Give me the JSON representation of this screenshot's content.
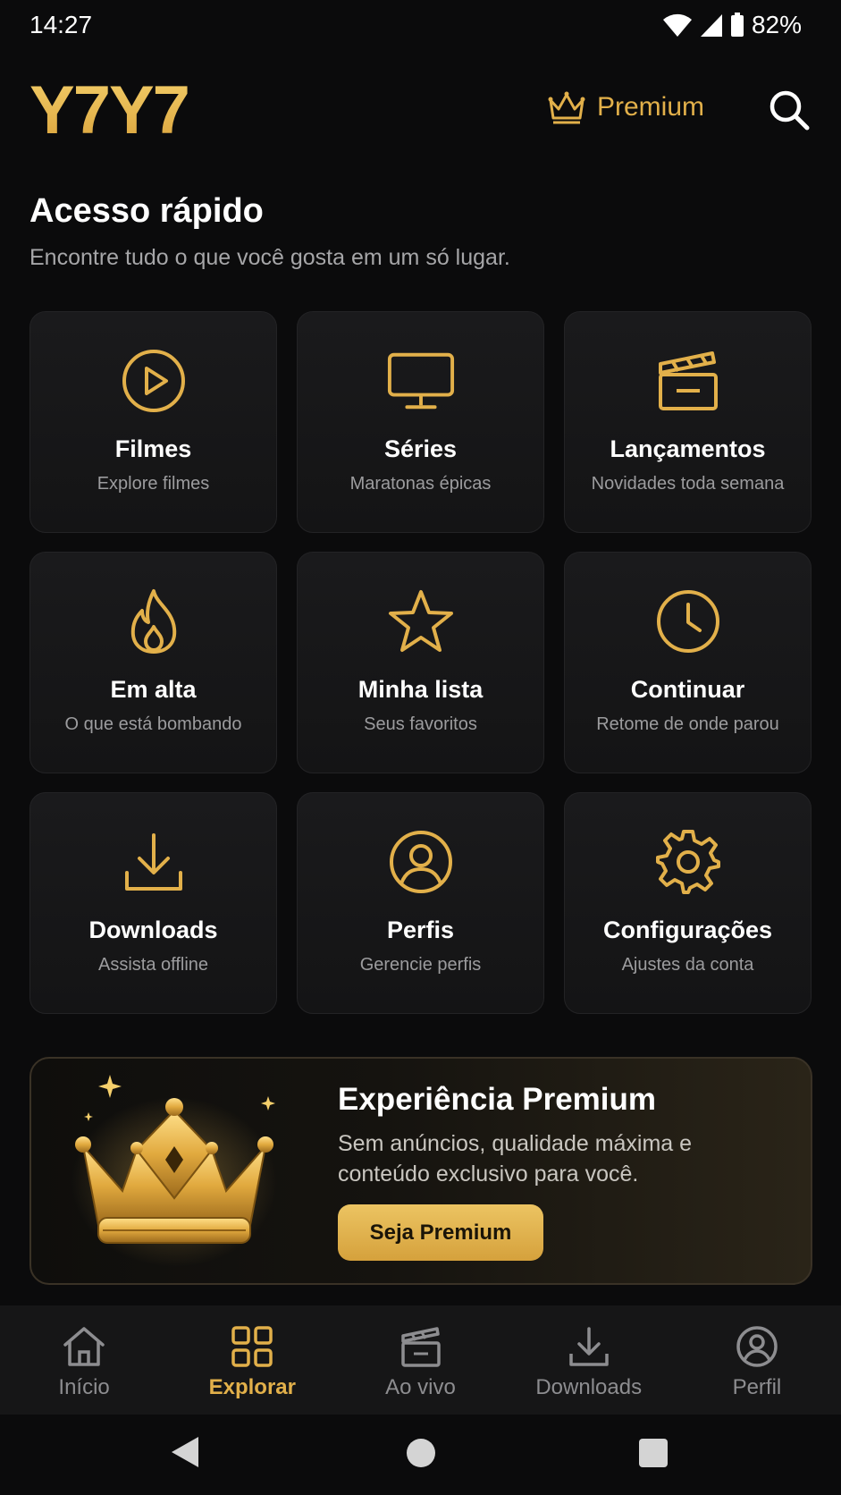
{
  "status": {
    "time": "14:27",
    "battery": "82%"
  },
  "header": {
    "logo": "Y7Y7",
    "premium_label": "Premium"
  },
  "section": {
    "title": "Acesso rápido",
    "subtitle": "Encontre tudo o que você gosta em um só lugar."
  },
  "tiles": [
    {
      "title": "Filmes",
      "subtitle": "Explore filmes",
      "icon": "play-circle-icon"
    },
    {
      "title": "Séries",
      "subtitle": "Maratonas épicas",
      "icon": "monitor-icon"
    },
    {
      "title": "Lançamentos",
      "subtitle": "Novidades toda semana",
      "icon": "clapperboard-icon"
    },
    {
      "title": "Em alta",
      "subtitle": "O que está bombando",
      "icon": "flame-icon"
    },
    {
      "title": "Minha lista",
      "subtitle": "Seus favoritos",
      "icon": "star-icon"
    },
    {
      "title": "Continuar",
      "subtitle": "Retome de onde parou",
      "icon": "clock-icon"
    },
    {
      "title": "Downloads",
      "subtitle": "Assista offline",
      "icon": "download-icon"
    },
    {
      "title": "Perfis",
      "subtitle": "Gerencie perfis",
      "icon": "user-circle-icon"
    },
    {
      "title": "Configurações",
      "subtitle": "Ajustes da conta",
      "icon": "gear-icon"
    }
  ],
  "promo": {
    "title": "Experiência Premium",
    "text": "Sem anúncios, qualidade máxima e conteúdo exclusivo para você.",
    "button": "Seja Premium"
  },
  "bottom_nav": [
    {
      "label": "Início",
      "icon": "home-icon",
      "active": false
    },
    {
      "label": "Explorar",
      "icon": "grid-icon",
      "active": true
    },
    {
      "label": "Ao vivo",
      "icon": "clapperboard-icon",
      "active": false
    },
    {
      "label": "Downloads",
      "icon": "download-icon",
      "active": false
    },
    {
      "label": "Perfil",
      "icon": "user-circle-icon",
      "active": false
    }
  ],
  "colors": {
    "accent": "#e2b04a",
    "background": "#0b0b0c",
    "tile": "#1a1a1c"
  }
}
